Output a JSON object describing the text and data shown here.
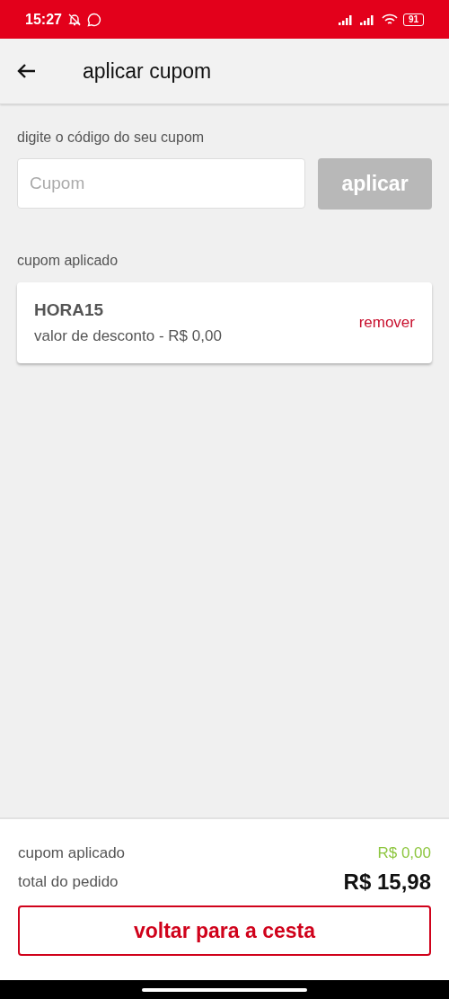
{
  "status_bar": {
    "time": "15:27",
    "battery": "91"
  },
  "header": {
    "title": "aplicar cupom"
  },
  "coupon_entry": {
    "label": "digite o código do seu cupom",
    "placeholder": "Cupom",
    "button": {
      "label": "aplicar",
      "disabled": true
    }
  },
  "applied": {
    "label": "cupom aplicado",
    "code": "HORA15",
    "discount": "valor de desconto - R$ 0,00",
    "remove": "remover"
  },
  "summary": {
    "rows": [
      {
        "label": "cupom aplicado",
        "value": "R$ 0,00",
        "kind": "discount"
      },
      {
        "label": "total do pedido",
        "value": "R$ 15,98",
        "kind": "total"
      }
    ],
    "button": "voltar para a cesta"
  }
}
